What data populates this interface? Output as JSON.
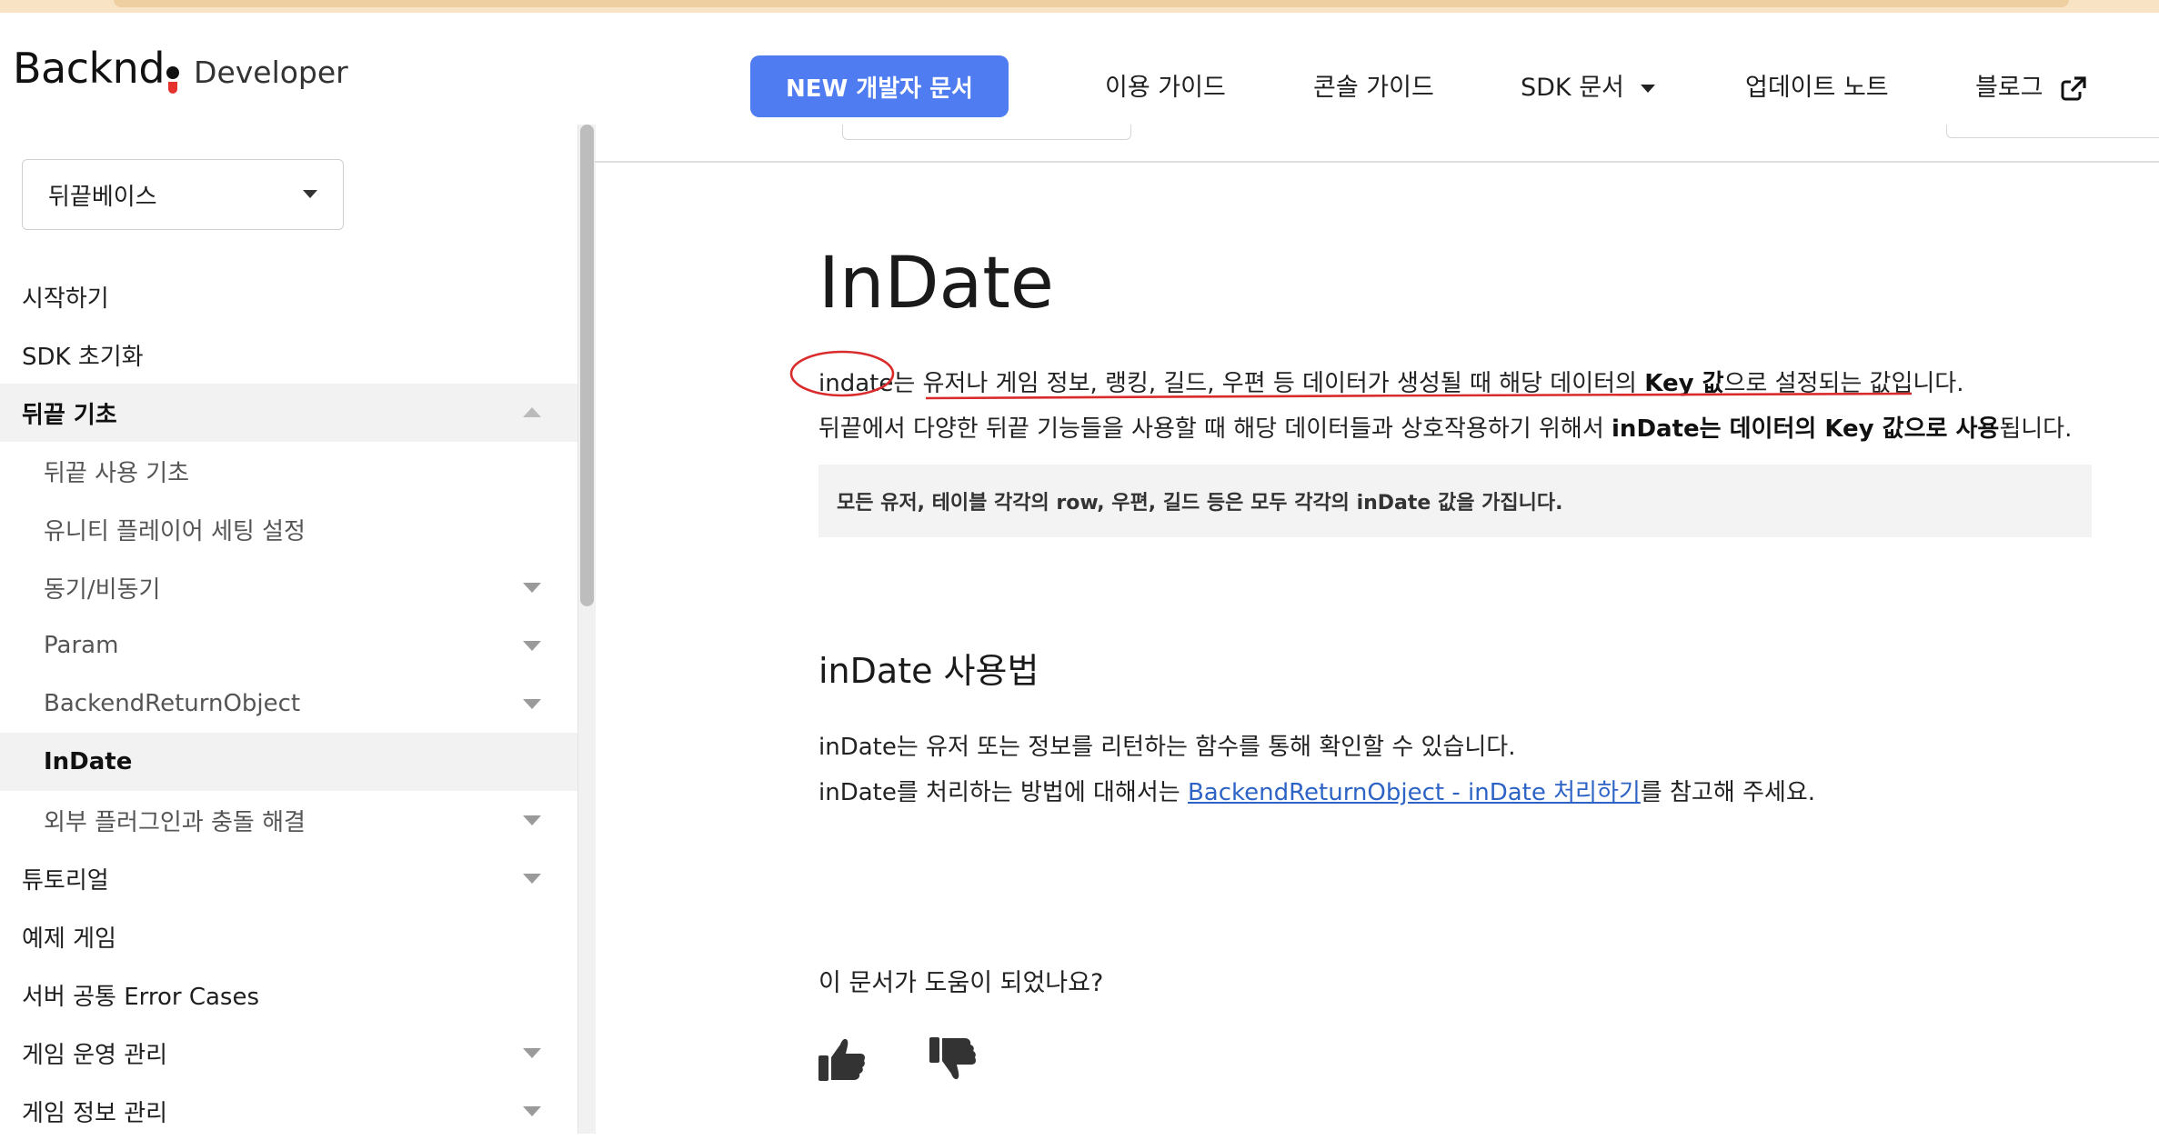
{
  "header": {
    "logo_word": "Backnd",
    "logo_sub": "Developer",
    "new_docs_label": "NEW 개발자 문서",
    "nav": {
      "usage_guide": "이용 가이드",
      "console_guide": "콘솔 가이드",
      "sdk_docs": "SDK 문서",
      "update_notes": "업데이트 노트",
      "blog": "블로그"
    },
    "icons": {
      "sdk_dropdown": "caret-down-icon",
      "blog_external": "external-link-icon"
    }
  },
  "sidebar": {
    "select_value": "뒤끝베이스",
    "items": [
      {
        "label": "시작하기"
      },
      {
        "label": "SDK 초기화"
      },
      {
        "label": "뒤끝 기초"
      },
      {
        "label": "뒤끝 사용 기초"
      },
      {
        "label": "유니티 플레이어 세팅 설정"
      },
      {
        "label": "동기/비동기"
      },
      {
        "label": "Param"
      },
      {
        "label": "BackendReturnObject"
      },
      {
        "label": "InDate"
      },
      {
        "label": "외부 플러그인과 충돌 해결"
      },
      {
        "label": "튜토리얼"
      },
      {
        "label": "예제 게임"
      },
      {
        "label": "서버 공통 Error Cases"
      },
      {
        "label": "게임 운영 관리"
      },
      {
        "label": "게임 정보 관리"
      }
    ]
  },
  "content": {
    "title": "InDate",
    "para1": {
      "a": "indate는 유저나 게임 정보, 랭킹, 길드, 우편 등 데이터가 생성될 때 해당 데이터의 ",
      "b": "Key 값",
      "c": "으로 설정되는 값입니다."
    },
    "para2": {
      "a": "뒤끝에서 다양한 뒤끝 기능들을 사용할 때 해당 데이터들과 상호작용하기 위해서 ",
      "b": "inDate는 데이터의 Key 값으로 사용",
      "c": "됩니다."
    },
    "note": "모든 유저, 테이블 각각의 row, 우편, 길드 등은 모두 각각의 inDate 값을 가집니다.",
    "section_title": "inDate 사용법",
    "para3": "inDate는 유저 또는 정보를 리턴하는 함수를 통해 확인할 수 있습니다.",
    "para4": {
      "a": "inDate를 처리하는 방법에 대해서는 ",
      "link": "BackendReturnObject - inDate 처리하기",
      "c": "를 참고해 주세요."
    },
    "feedback_question": "이 문서가 도움이 되었나요?",
    "feedback_icons": {
      "up": "thumbs-up-icon",
      "down": "thumbs-down-icon"
    }
  },
  "colors": {
    "primary_button": "#4f7cf0",
    "link": "#2c63c5",
    "annotation": "#d92b2b",
    "active_bg": "#f2f2f2"
  }
}
